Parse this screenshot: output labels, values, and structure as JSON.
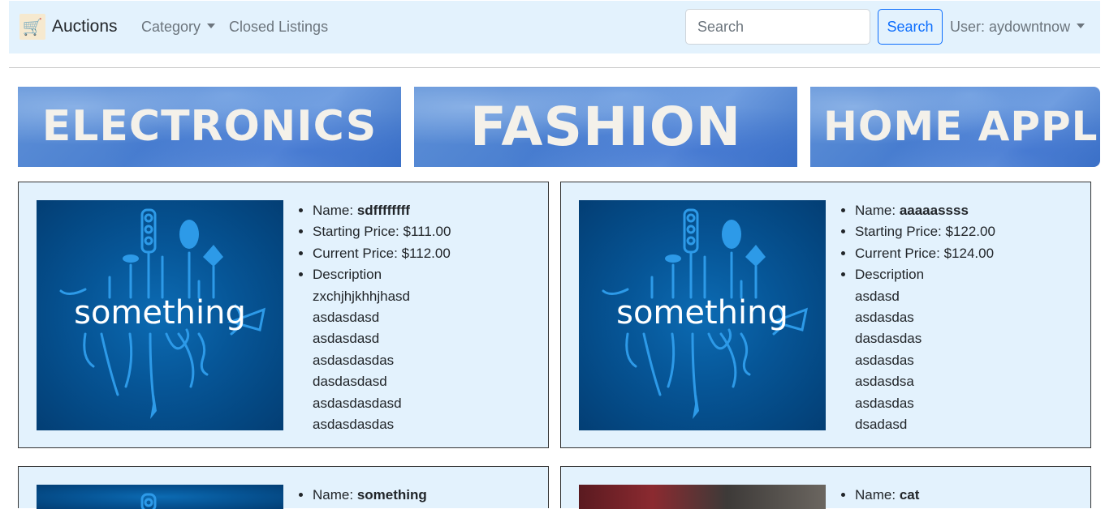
{
  "navbar": {
    "brand": "Auctions",
    "logo_icon": "shopping-cart-icon",
    "category_label": "Category",
    "closed_listings_label": "Closed Listings",
    "search_placeholder": "Search",
    "search_value": "",
    "search_button": "Search",
    "user_label": "User: aydowntnow"
  },
  "banners": [
    {
      "label": "ELECTRONICS"
    },
    {
      "label": "FASHION"
    },
    {
      "label": "HOME APPLIA"
    }
  ],
  "listings": [
    {
      "name_label": "Name:",
      "name": "sdffffffff",
      "starting_price": "Starting Price: $111.00",
      "current_price": "Current Price: $112.00",
      "description_label": "Description",
      "description": [
        "zxchjhjkhhjhasd",
        "asdasdasd",
        "asdasdasd",
        "asdasdasdas",
        "dasdasdasd",
        "asdasdasdasd",
        "asdasdasdas"
      ],
      "image_text": "something"
    },
    {
      "name_label": "Name:",
      "name": "aaaaassss",
      "starting_price": "Starting Price: $122.00",
      "current_price": "Current Price: $124.00",
      "description_label": "Description",
      "description": [
        "asdasd",
        "asdasdas",
        "dasdasdas",
        "asdasdas",
        "asdasdsa",
        "asdasdas",
        "dsadasd"
      ],
      "image_text": "something"
    },
    {
      "name_label": "Name:",
      "name": "something"
    },
    {
      "name_label": "Name:",
      "name": "cat"
    }
  ],
  "colors": {
    "navbar_bg": "#e3f2fd",
    "card_bg": "#e3f2fd",
    "accent": "#0d6efd",
    "banner_blue": "#4a7fd0"
  }
}
